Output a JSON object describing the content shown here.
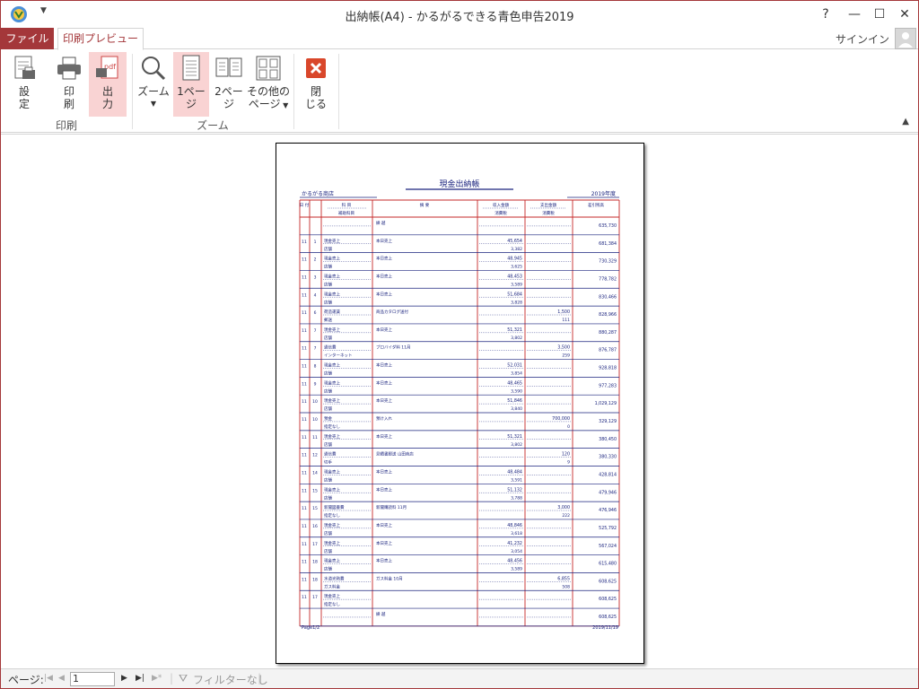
{
  "window": {
    "title": "出納帳(A4) - かるがるできる青色申告2019",
    "help": "?",
    "minimize": "—",
    "maximize": "☐",
    "close": "✕"
  },
  "tabs": {
    "file": "ファイル",
    "print_preview": "印刷プレビュー"
  },
  "account": {
    "signin": "サインイン"
  },
  "ribbon": {
    "print_group": {
      "label": "印刷",
      "settings_l1": "設",
      "settings_l2": "定",
      "print_l1": "印",
      "print_l2": "刷",
      "output_l1": "出",
      "output_l2": "力"
    },
    "zoom_group": {
      "label": "ズーム",
      "zoom": "ズーム",
      "one_page_l1": "1ペー",
      "one_page_l2": "ジ",
      "two_page_l1": "2ペー",
      "two_page_l2": "ジ",
      "other_l1": "その他の",
      "other_l2": "ページ"
    },
    "close_group": {
      "close_l1": "閉",
      "close_l2": "じる"
    }
  },
  "report": {
    "title": "現金出納帳",
    "company": "かるがる商店",
    "year": "2019年度",
    "headers": {
      "date": "日 付",
      "account": "科 目",
      "sub_account": "補助科目",
      "summary": "摘 要",
      "income": "収入金額",
      "income_tax": "消費税",
      "expense": "支出金額",
      "expense_tax": "消費税",
      "balance": "差引残高"
    },
    "rows": [
      {
        "m": "",
        "d": "",
        "acc": "",
        "sub": "",
        "summary": "繰 越",
        "inc": "",
        "inct": "",
        "exp": "",
        "expt": "",
        "bal": "635,730"
      },
      {
        "m": "11",
        "d": "1",
        "acc": "現金売上",
        "sub": "店舗",
        "summary": "本日売上",
        "inc": "45,654",
        "inct": "3,382",
        "exp": "",
        "expt": "",
        "bal": "681,384"
      },
      {
        "m": "11",
        "d": "2",
        "acc": "現金売上",
        "sub": "店舗",
        "summary": "本日売上",
        "inc": "48,945",
        "inct": "3,625",
        "exp": "",
        "expt": "",
        "bal": "730,329"
      },
      {
        "m": "11",
        "d": "3",
        "acc": "現金売上",
        "sub": "店舗",
        "summary": "本日売上",
        "inc": "48,453",
        "inct": "3,589",
        "exp": "",
        "expt": "",
        "bal": "778,782"
      },
      {
        "m": "11",
        "d": "4",
        "acc": "現金売上",
        "sub": "店舗",
        "summary": "本日売上",
        "inc": "51,684",
        "inct": "3,828",
        "exp": "",
        "expt": "",
        "bal": "830,466"
      },
      {
        "m": "11",
        "d": "6",
        "acc": "荷造運賃",
        "sub": "郵送",
        "summary": "商品カタログ送付",
        "inc": "",
        "inct": "",
        "exp": "1,500",
        "expt": "111",
        "bal": "828,966"
      },
      {
        "m": "11",
        "d": "7",
        "acc": "現金売上",
        "sub": "店舗",
        "summary": "本日売上",
        "inc": "51,321",
        "inct": "3,802",
        "exp": "",
        "expt": "",
        "bal": "880,287"
      },
      {
        "m": "11",
        "d": "7",
        "acc": "通信費",
        "sub": "インターネット",
        "summary": "プロバイダ料 11月",
        "inc": "",
        "inct": "",
        "exp": "3,500",
        "expt": "259",
        "bal": "876,787"
      },
      {
        "m": "11",
        "d": "8",
        "acc": "現金売上",
        "sub": "店舗",
        "summary": "本日売上",
        "inc": "52,031",
        "inct": "3,854",
        "exp": "",
        "expt": "",
        "bal": "928,818"
      },
      {
        "m": "11",
        "d": "9",
        "acc": "現金売上",
        "sub": "店舗",
        "summary": "本日売上",
        "inc": "48,465",
        "inct": "3,590",
        "exp": "",
        "expt": "",
        "bal": "977,283"
      },
      {
        "m": "11",
        "d": "10",
        "acc": "現金売上",
        "sub": "店舗",
        "summary": "本日売上",
        "inc": "51,846",
        "inct": "3,840",
        "exp": "",
        "expt": "",
        "bal": "1,029,129"
      },
      {
        "m": "11",
        "d": "10",
        "acc": "預金",
        "sub": "指定なし",
        "summary": "預け入れ",
        "inc": "",
        "inct": "",
        "exp": "700,000",
        "expt": "0",
        "bal": "329,129"
      },
      {
        "m": "11",
        "d": "11",
        "acc": "現金売上",
        "sub": "店舗",
        "summary": "本日売上",
        "inc": "51,321",
        "inct": "3,802",
        "exp": "",
        "expt": "",
        "bal": "380,450"
      },
      {
        "m": "11",
        "d": "12",
        "acc": "通信費",
        "sub": "切手",
        "summary": "見積書郵送 山田商店",
        "inc": "",
        "inct": "",
        "exp": "120",
        "expt": "9",
        "bal": "380,330"
      },
      {
        "m": "11",
        "d": "14",
        "acc": "現金売上",
        "sub": "店舗",
        "summary": "本日売上",
        "inc": "48,484",
        "inct": "3,591",
        "exp": "",
        "expt": "",
        "bal": "428,814"
      },
      {
        "m": "11",
        "d": "15",
        "acc": "現金売上",
        "sub": "店舗",
        "summary": "本日売上",
        "inc": "51,132",
        "inct": "3,788",
        "exp": "",
        "expt": "",
        "bal": "479,946"
      },
      {
        "m": "11",
        "d": "15",
        "acc": "新聞図書費",
        "sub": "指定なし",
        "summary": "新聞購読料 11月",
        "inc": "",
        "inct": "",
        "exp": "3,000",
        "expt": "222",
        "bal": "476,946"
      },
      {
        "m": "11",
        "d": "16",
        "acc": "現金売上",
        "sub": "店舗",
        "summary": "本日売上",
        "inc": "48,846",
        "inct": "3,618",
        "exp": "",
        "expt": "",
        "bal": "525,792"
      },
      {
        "m": "11",
        "d": "17",
        "acc": "現金売上",
        "sub": "店舗",
        "summary": "本日売上",
        "inc": "41,232",
        "inct": "3,054",
        "exp": "",
        "expt": "",
        "bal": "567,024"
      },
      {
        "m": "11",
        "d": "18",
        "acc": "現金売上",
        "sub": "店舗",
        "summary": "本日売上",
        "inc": "48,456",
        "inct": "3,589",
        "exp": "",
        "expt": "",
        "bal": "615,480"
      },
      {
        "m": "11",
        "d": "18",
        "acc": "水道光熱費",
        "sub": "ガス料金",
        "summary": "ガス料金 10月",
        "inc": "",
        "inct": "",
        "exp": "6,855",
        "expt": "508",
        "bal": "608,625"
      },
      {
        "m": "11",
        "d": "17",
        "acc": "現金売上",
        "sub": "指定なし",
        "summary": "",
        "inc": "",
        "inct": "",
        "exp": "",
        "expt": "",
        "bal": "608,625"
      },
      {
        "m": "",
        "d": "",
        "acc": "",
        "sub": "",
        "summary": "繰 越",
        "inc": "",
        "inct": "",
        "exp": "",
        "expt": "",
        "bal": "608,625"
      }
    ],
    "footer_page": "Page1/2",
    "footer_date": "2019/11/19"
  },
  "statusbar": {
    "page_label": "ページ:",
    "page_value": "1",
    "filter": "フィルターなし"
  },
  "colors": {
    "accent": "#a4373a",
    "report_line": "#c62828",
    "report_text": "#1a237e"
  }
}
